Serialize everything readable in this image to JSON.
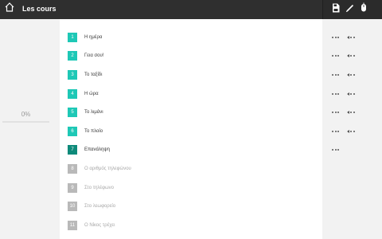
{
  "header": {
    "title": "Les cours",
    "home_icon": "home-icon",
    "tools": [
      {
        "name": "save-icon"
      },
      {
        "name": "pencil-icon"
      },
      {
        "name": "mouse-icon"
      }
    ]
  },
  "progress": {
    "label": "0%",
    "value": 0
  },
  "lessons": [
    {
      "number": "1",
      "title": "Η ημέρα",
      "state": "done"
    },
    {
      "number": "2",
      "title": "Γεια σου!",
      "state": "done"
    },
    {
      "number": "3",
      "title": "Το ταξίδι",
      "state": "done"
    },
    {
      "number": "4",
      "title": "Η ώρα",
      "state": "done"
    },
    {
      "number": "5",
      "title": "Το λιμάνι",
      "state": "done"
    },
    {
      "number": "6",
      "title": "Το πλοίο",
      "state": "done"
    },
    {
      "number": "7",
      "title": "Επανάληψη",
      "state": "current"
    },
    {
      "number": "8",
      "title": "Ο αριθμός τηλεφώνου",
      "state": "locked"
    },
    {
      "number": "9",
      "title": "Στο τηλέφωνο",
      "state": "locked"
    },
    {
      "number": "10",
      "title": "Στο λεωφορείο",
      "state": "locked"
    },
    {
      "number": "11",
      "title": "Ο Νίκος τρέχει",
      "state": "locked"
    }
  ],
  "row_controls": [
    {
      "type": "dots-tri"
    },
    {
      "type": "dots-tri"
    },
    {
      "type": "dots-tri"
    },
    {
      "type": "dots-tri"
    },
    {
      "type": "dots-tri"
    },
    {
      "type": "dots-tri"
    },
    {
      "type": "dots"
    }
  ],
  "colors": {
    "topbar": "#2f2f2f",
    "done": "#1ec8b6",
    "current": "#0e8a7a",
    "locked": "#b9b9b9"
  }
}
